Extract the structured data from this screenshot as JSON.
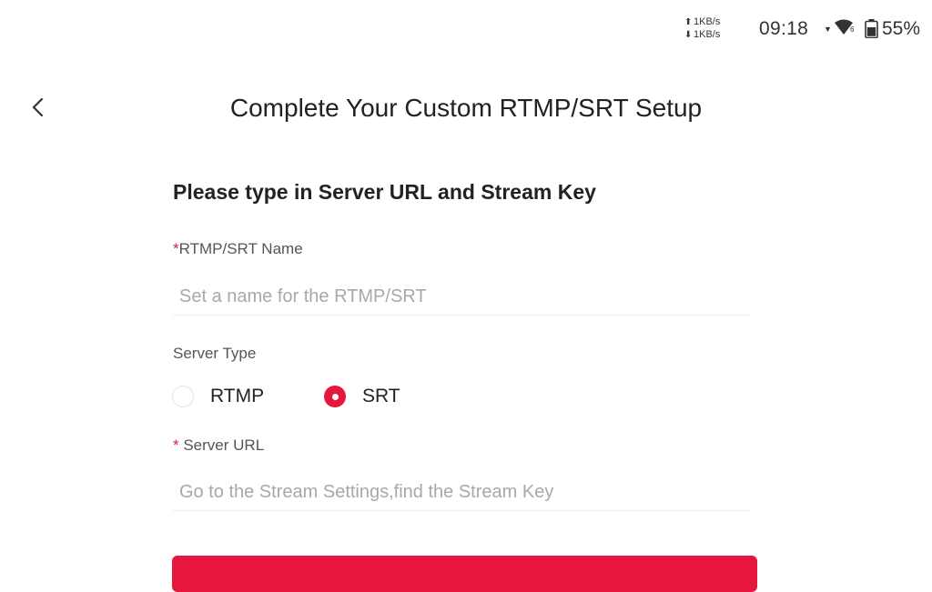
{
  "status_bar": {
    "upload_speed": "1KB/s",
    "download_speed": "1KB/s",
    "time": "09:18",
    "network_type": "6",
    "battery": "55%"
  },
  "header": {
    "title": "Complete Your Custom RTMP/SRT Setup"
  },
  "form": {
    "section_title": "Please type in Server URL and Stream Key",
    "required_mark": "*",
    "name_label": "RTMP/SRT Name",
    "name_value": "",
    "name_placeholder": "Set a name for the RTMP/SRT",
    "server_type_label": "Server Type",
    "server_type_options": [
      "RTMP",
      "SRT"
    ],
    "server_type_selected": "SRT",
    "server_url_label": " Server URL",
    "server_url_value": "",
    "server_url_placeholder": "Go to the Stream Settings,find the Stream Key"
  },
  "colors": {
    "accent": "#e6163e",
    "text": "#222222",
    "placeholder": "#a8a8a8"
  },
  "icons": {
    "back": "chevron-left-icon",
    "wifi": "wifi-icon",
    "battery": "battery-icon"
  }
}
